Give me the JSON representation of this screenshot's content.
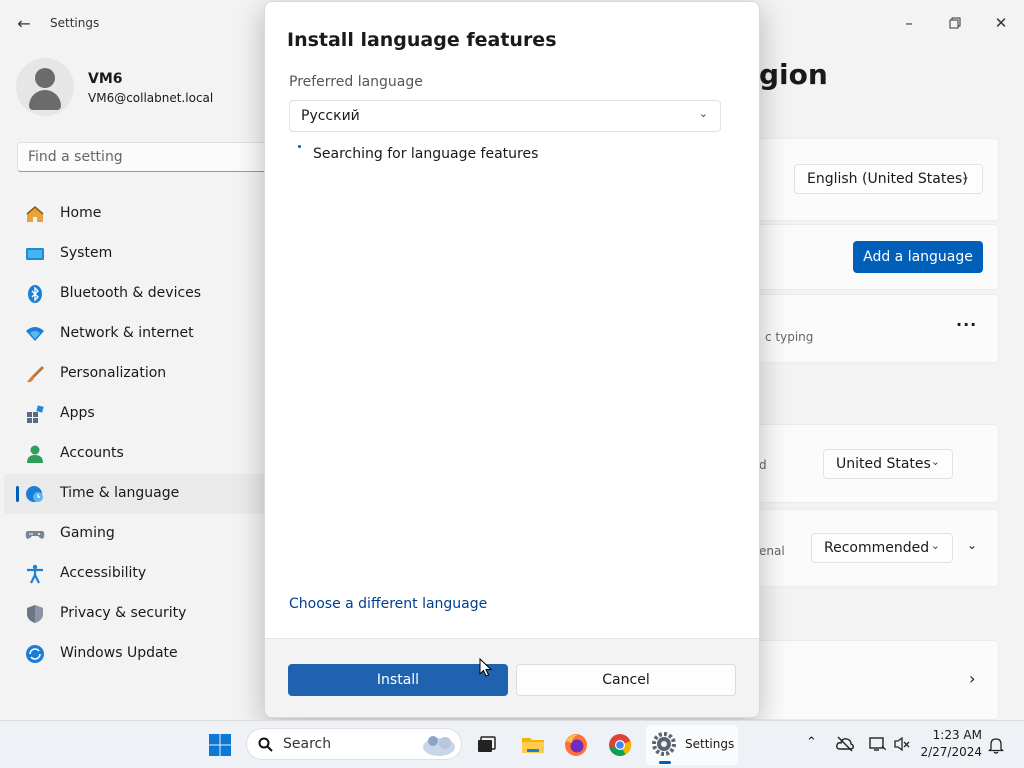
{
  "window": {
    "app_title": "Settings",
    "controls": [
      "minimize-icon",
      "restore-icon",
      "close-icon"
    ]
  },
  "profile": {
    "name": "VM6",
    "email": "VM6@collabnet.local"
  },
  "search": {
    "placeholder": "Find a setting"
  },
  "sidebar": {
    "items": [
      {
        "label": "Home",
        "icon": "home-icon"
      },
      {
        "label": "System",
        "icon": "system-icon"
      },
      {
        "label": "Bluetooth & devices",
        "icon": "bluetooth-icon"
      },
      {
        "label": "Network & internet",
        "icon": "network-icon"
      },
      {
        "label": "Personalization",
        "icon": "brush-icon"
      },
      {
        "label": "Apps",
        "icon": "apps-icon"
      },
      {
        "label": "Accounts",
        "icon": "accounts-icon"
      },
      {
        "label": "Time & language",
        "icon": "time-language-icon",
        "active": true
      },
      {
        "label": "Gaming",
        "icon": "gaming-icon"
      },
      {
        "label": "Accessibility",
        "icon": "accessibility-icon"
      },
      {
        "label": "Privacy & security",
        "icon": "shield-icon"
      },
      {
        "label": "Windows Update",
        "icon": "update-icon"
      }
    ]
  },
  "main": {
    "heading_fragment": "egion",
    "display_language": "English (United States)",
    "add_language_button": "Add a language",
    "typing_fragment": "c typing",
    "country_value": "United States",
    "region_format_value": "Recommended",
    "country_fragment": "d",
    "format_fragment": "enal"
  },
  "dialog": {
    "title": "Install language features",
    "preferred_label": "Preferred language",
    "preferred_value": "Русский",
    "status_text": "Searching for language features",
    "link_text": "Choose a different language",
    "install_button": "Install",
    "cancel_button": "Cancel"
  },
  "taskbar": {
    "search_label": "Search",
    "settings_label": "Settings",
    "time": "1:23 AM",
    "date": "2/27/2024"
  },
  "colors": {
    "accent": "#005fb8",
    "link": "#003e92"
  }
}
